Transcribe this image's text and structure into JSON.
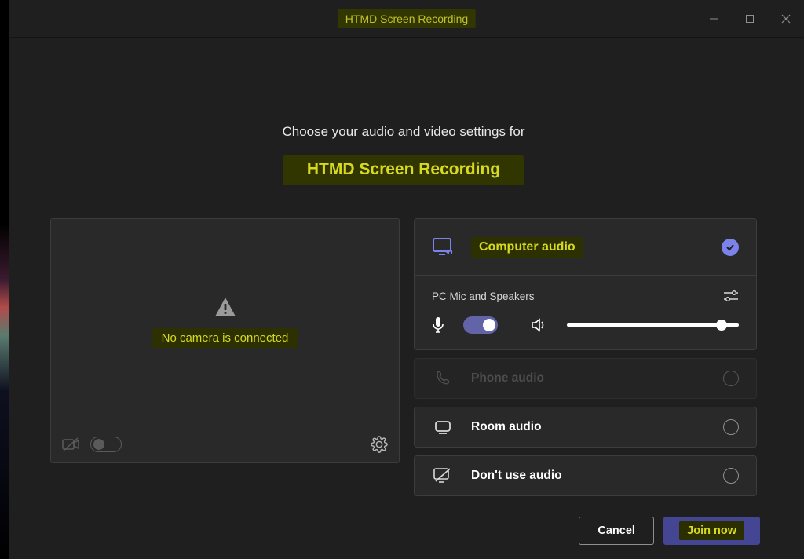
{
  "titlebar": {
    "title": "HTMD Screen Recording"
  },
  "heading": {
    "line1": "Choose your audio and video settings for",
    "line2": "HTMD Screen Recording"
  },
  "camera": {
    "message": "No camera is connected"
  },
  "audio": {
    "computer": {
      "label": "Computer audio",
      "device_label": "PC Mic and Speakers",
      "mic_on": true,
      "volume_pct": 90
    },
    "phone": {
      "label": "Phone audio",
      "enabled": false
    },
    "room": {
      "label": "Room audio",
      "enabled": true
    },
    "none": {
      "label": "Don't use audio",
      "enabled": true
    }
  },
  "footer": {
    "cancel": "Cancel",
    "join": "Join now"
  },
  "colors": {
    "highlight_text": "#d7da1f",
    "highlight_bg": "#313500",
    "accent": "#6264a7"
  }
}
